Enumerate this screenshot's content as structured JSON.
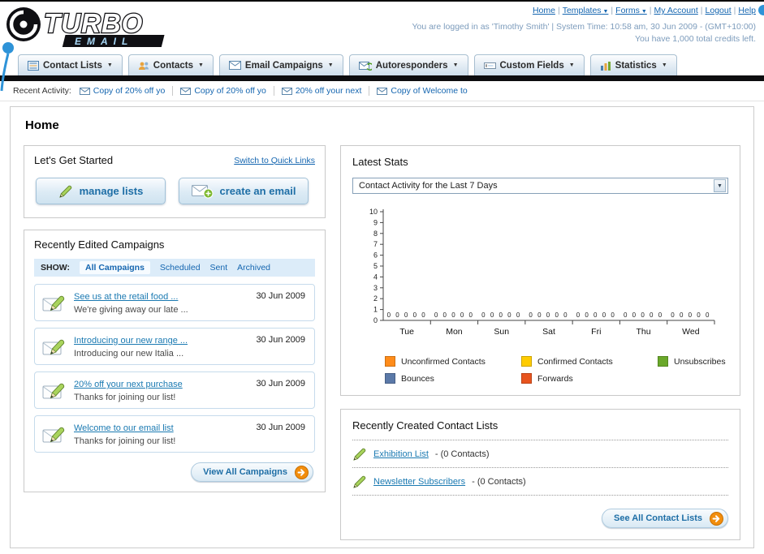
{
  "header": {
    "logo": {
      "primary": "TURBO",
      "secondary": "EMAIL"
    },
    "links": [
      {
        "label": "Home",
        "dropdown": false
      },
      {
        "label": "Templates",
        "dropdown": true
      },
      {
        "label": "Forms",
        "dropdown": true
      },
      {
        "label": "My Account",
        "dropdown": false
      },
      {
        "label": "Logout",
        "dropdown": false
      },
      {
        "label": "Help",
        "dropdown": false
      }
    ],
    "login_info": "You are logged in as 'Timothy Smith' | System Time: 10:58 am, 30 Jun 2009 - (GMT+10:00)",
    "credits_info": "You have 1,000 total credits left."
  },
  "main_nav": [
    {
      "label": "Contact Lists",
      "icon": "contact-lists-icon"
    },
    {
      "label": "Contacts",
      "icon": "contacts-icon"
    },
    {
      "label": "Email Campaigns",
      "icon": "email-campaigns-icon"
    },
    {
      "label": "Autoresponders",
      "icon": "autoresponders-icon"
    },
    {
      "label": "Custom Fields",
      "icon": "custom-fields-icon"
    },
    {
      "label": "Statistics",
      "icon": "statistics-icon"
    }
  ],
  "recent_activity": {
    "label": "Recent Activity:",
    "items": [
      "Copy of 20% off yo",
      "Copy of 20% off yo",
      "20% off your next",
      "Copy of Welcome to"
    ]
  },
  "page": {
    "title": "Home"
  },
  "get_started": {
    "title": "Let's Get Started",
    "switch_link": "Switch to Quick Links",
    "manage_lists_label": "manage lists",
    "create_email_label": "create an email"
  },
  "campaigns": {
    "title": "Recently Edited Campaigns",
    "show_label": "SHOW:",
    "tabs": [
      {
        "label": "All Campaigns",
        "active": true
      },
      {
        "label": "Scheduled",
        "active": false
      },
      {
        "label": "Sent",
        "active": false
      },
      {
        "label": "Archived",
        "active": false
      }
    ],
    "items": [
      {
        "title": "See us at the retail food ...",
        "subtitle": "We're giving away our late ...",
        "date": "30 Jun 2009"
      },
      {
        "title": "Introducing our new range ...",
        "subtitle": "Introducing our new Italia ...",
        "date": "30 Jun 2009"
      },
      {
        "title": "20% off your next purchase",
        "subtitle": "Thanks for joining our list!",
        "date": "30 Jun 2009"
      },
      {
        "title": "Welcome to our email list",
        "subtitle": "Thanks for joining our list!",
        "date": "30 Jun 2009"
      }
    ],
    "view_all_label": "View All Campaigns"
  },
  "stats": {
    "title": "Latest Stats",
    "selected_option": "Contact Activity for the Last 7 Days"
  },
  "chart_data": {
    "type": "bar",
    "title": "Contact Activity for the Last 7 Days",
    "categories": [
      "Tue",
      "Mon",
      "Sun",
      "Sat",
      "Fri",
      "Thu",
      "Wed"
    ],
    "series": [
      {
        "name": "Unconfirmed Contacts",
        "color": "#ff8c1a",
        "values": [
          0,
          0,
          0,
          0,
          0,
          0,
          0
        ]
      },
      {
        "name": "Confirmed Contacts",
        "color": "#ffcc00",
        "values": [
          0,
          0,
          0,
          0,
          0,
          0,
          0
        ]
      },
      {
        "name": "Unsubscribes",
        "color": "#6aa82a",
        "values": [
          0,
          0,
          0,
          0,
          0,
          0,
          0
        ]
      },
      {
        "name": "Bounces",
        "color": "#5b79a8",
        "values": [
          0,
          0,
          0,
          0,
          0,
          0,
          0
        ]
      },
      {
        "name": "Forwards",
        "color": "#e8541e",
        "values": [
          0,
          0,
          0,
          0,
          0,
          0,
          0
        ]
      }
    ],
    "ylim": [
      0,
      10
    ],
    "ytick_step": 1,
    "grid": false,
    "legend_position": "bottom",
    "value_labels_shown": true
  },
  "contact_lists": {
    "title": "Recently Created Contact Lists",
    "items": [
      {
        "name": "Exhibition List",
        "detail": "- (0 Contacts)"
      },
      {
        "name": "Newsletter Subscribers",
        "detail": "- (0 Contacts)"
      }
    ],
    "see_all_label": "See All Contact Lists"
  }
}
